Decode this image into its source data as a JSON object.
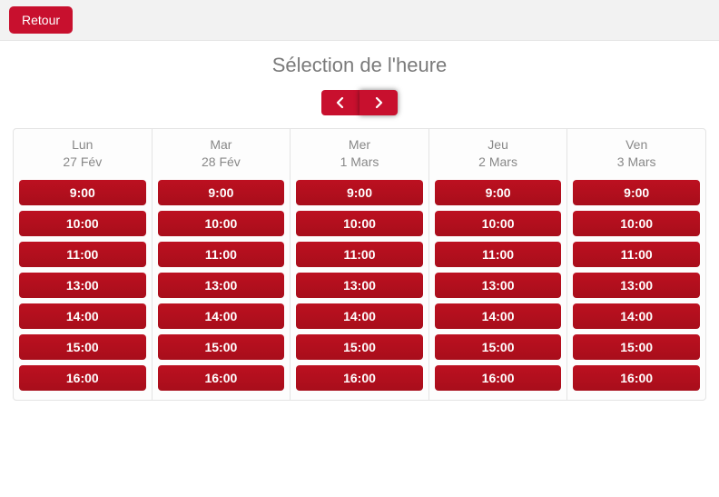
{
  "header": {
    "back_label": "Retour"
  },
  "title": "Sélection de l'heure",
  "days": [
    {
      "dow": "Lun",
      "date": "27 Fév",
      "slots": [
        "9:00",
        "10:00",
        "11:00",
        "13:00",
        "14:00",
        "15:00",
        "16:00"
      ]
    },
    {
      "dow": "Mar",
      "date": "28 Fév",
      "slots": [
        "9:00",
        "10:00",
        "11:00",
        "13:00",
        "14:00",
        "15:00",
        "16:00"
      ]
    },
    {
      "dow": "Mer",
      "date": "1 Mars",
      "slots": [
        "9:00",
        "10:00",
        "11:00",
        "13:00",
        "14:00",
        "15:00",
        "16:00"
      ]
    },
    {
      "dow": "Jeu",
      "date": "2 Mars",
      "slots": [
        "9:00",
        "10:00",
        "11:00",
        "13:00",
        "14:00",
        "15:00",
        "16:00"
      ]
    },
    {
      "dow": "Ven",
      "date": "3 Mars",
      "slots": [
        "9:00",
        "10:00",
        "11:00",
        "13:00",
        "14:00",
        "15:00",
        "16:00"
      ]
    }
  ]
}
